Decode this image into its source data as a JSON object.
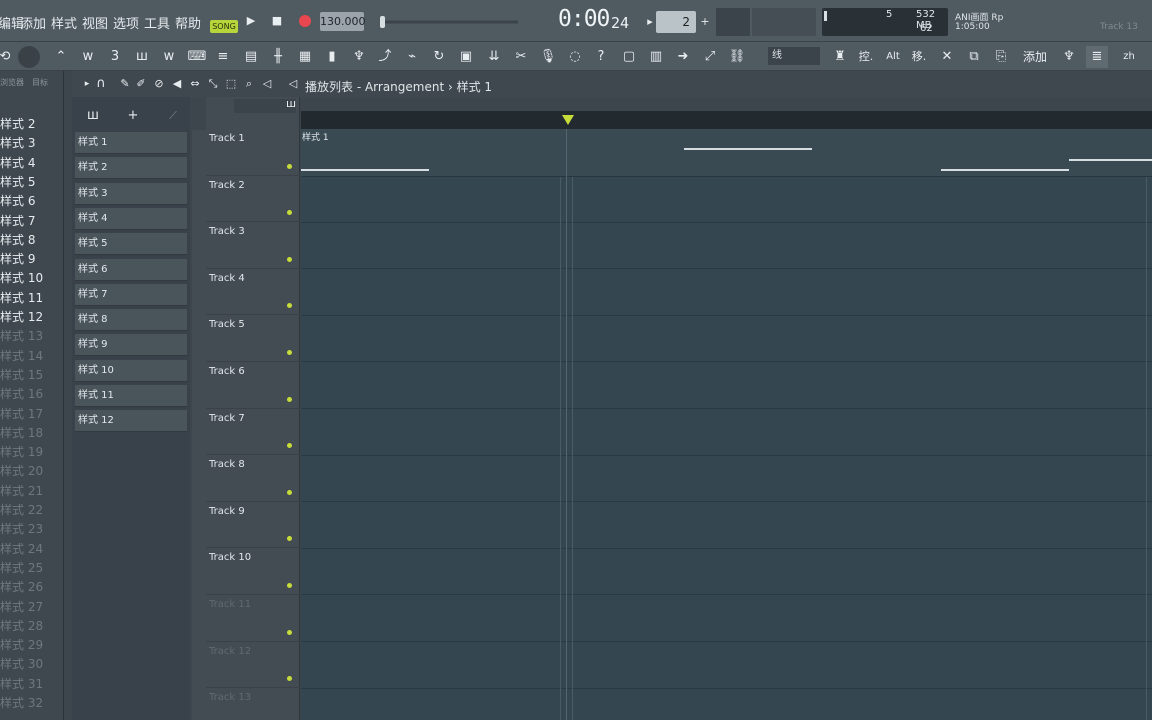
{
  "menu": [
    "编辑",
    "添加",
    "样式",
    "视图",
    "选项",
    "工具",
    "帮助"
  ],
  "transport": {
    "mode_label": "SONG",
    "tempo": "130.000",
    "time_main": "0:00",
    "time_sub": "24",
    "pattern_number": "2"
  },
  "status": {
    "cpu_value": "5",
    "memory": "532 MB",
    "polyphony": "62",
    "hint_title": "ANI画面 Rp",
    "hint_time": "1:05:00",
    "hint_track": "Track 13"
  },
  "toolbar": {
    "snap_label": "线",
    "ctrl_label": "控.",
    "alt_label": "Alt",
    "move_label": "移.",
    "add_label": "添加",
    "lang_label": "zh"
  },
  "browser": {
    "header_left": "浏览器",
    "header_right": "目标",
    "items": [
      {
        "label": "样式 2",
        "dim": false
      },
      {
        "label": "样式 3",
        "dim": false
      },
      {
        "label": "样式 4",
        "dim": false
      },
      {
        "label": "样式 5",
        "dim": false
      },
      {
        "label": "样式 6",
        "dim": false
      },
      {
        "label": "样式 7",
        "dim": false
      },
      {
        "label": "样式 8",
        "dim": false
      },
      {
        "label": "样式 9",
        "dim": false
      },
      {
        "label": "样式 10",
        "dim": false
      },
      {
        "label": "样式 11",
        "dim": false
      },
      {
        "label": "样式 12",
        "dim": false
      },
      {
        "label": "样式 13",
        "dim": true
      },
      {
        "label": "样式 14",
        "dim": true
      },
      {
        "label": "样式 15",
        "dim": true
      },
      {
        "label": "样式 16",
        "dim": true
      },
      {
        "label": "样式 17",
        "dim": true
      },
      {
        "label": "样式 18",
        "dim": true
      },
      {
        "label": "样式 19",
        "dim": true
      },
      {
        "label": "样式 20",
        "dim": true
      },
      {
        "label": "样式 21",
        "dim": true
      },
      {
        "label": "样式 22",
        "dim": true
      },
      {
        "label": "样式 23",
        "dim": true
      },
      {
        "label": "样式 24",
        "dim": true
      },
      {
        "label": "样式 25",
        "dim": true
      },
      {
        "label": "样式 26",
        "dim": true
      },
      {
        "label": "样式 27",
        "dim": true
      },
      {
        "label": "样式 28",
        "dim": true
      },
      {
        "label": "样式 29",
        "dim": true
      },
      {
        "label": "样式 30",
        "dim": true
      },
      {
        "label": "样式 31",
        "dim": true
      },
      {
        "label": "样式 32",
        "dim": true
      }
    ]
  },
  "playlist": {
    "breadcrumb": "播放列表 - Arrangement › 样式 1",
    "clip_label": "样式 1",
    "patterns": [
      "样式 1",
      "样式 2",
      "样式 3",
      "样式 4",
      "样式 5",
      "样式 6",
      "样式 7",
      "样式 8",
      "样式 9",
      "样式 10",
      "样式 11",
      "样式 12"
    ],
    "tracks": [
      {
        "name": "Track 1",
        "dim": false
      },
      {
        "name": "Track 2",
        "dim": false
      },
      {
        "name": "Track 3",
        "dim": false
      },
      {
        "name": "Track 4",
        "dim": false
      },
      {
        "name": "Track 5",
        "dim": false
      },
      {
        "name": "Track 6",
        "dim": false
      },
      {
        "name": "Track 7",
        "dim": false
      },
      {
        "name": "Track 8",
        "dim": false
      },
      {
        "name": "Track 9",
        "dim": false
      },
      {
        "name": "Track 10",
        "dim": false
      },
      {
        "name": "Track 11",
        "dim": true
      },
      {
        "name": "Track 12",
        "dim": true
      },
      {
        "name": "Track 13",
        "dim": true
      }
    ]
  },
  "colors": {
    "accent_green": "#c7dc3a",
    "record_red": "#e8474f",
    "grid_bg": "#34464f"
  }
}
